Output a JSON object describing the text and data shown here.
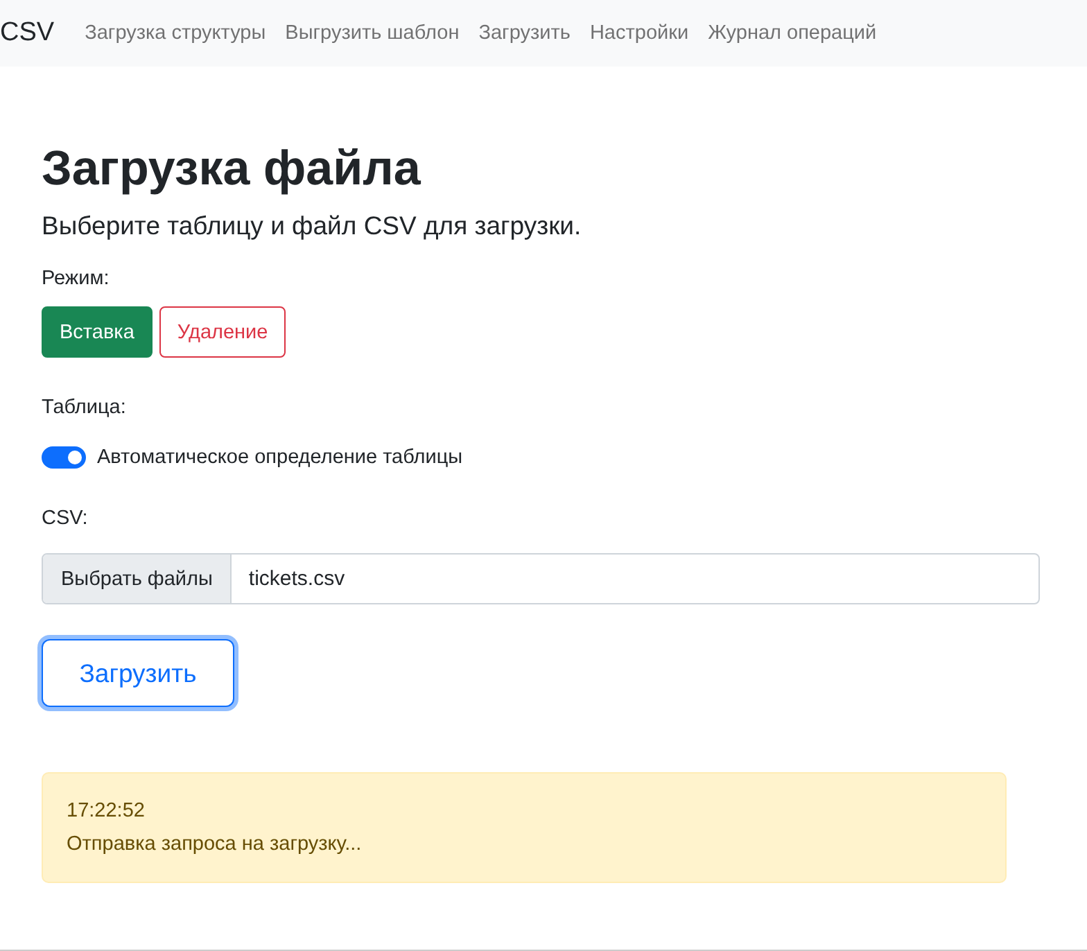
{
  "navbar": {
    "brand": "CSV",
    "links": [
      {
        "label": "Загрузка структуры"
      },
      {
        "label": "Выгрузить шаблон"
      },
      {
        "label": "Загрузить"
      },
      {
        "label": "Настройки"
      },
      {
        "label": "Журнал операций"
      }
    ]
  },
  "heading": "Загрузка файла",
  "lead": "Выберите таблицу и файл CSV для загрузки.",
  "mode": {
    "label": "Режим:",
    "options": [
      {
        "label": "Вставка",
        "selected": true
      },
      {
        "label": "Удаление",
        "selected": false
      }
    ]
  },
  "table": {
    "label": "Таблица:",
    "switch": {
      "label": "Автоматическое определение таблицы",
      "on": true
    }
  },
  "csv": {
    "label": "CSV:",
    "button": "Выбрать файлы",
    "file": "tickets.csv"
  },
  "upload_button": "Загрузить",
  "alert": {
    "time": "17:22:52",
    "message": "Отправка запроса на загрузку..."
  }
}
